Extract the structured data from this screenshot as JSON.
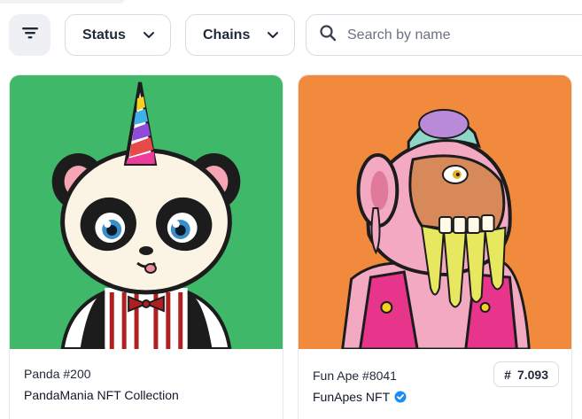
{
  "toolbar": {
    "filter_icon": "filter-lines-icon",
    "status_label": "Status",
    "chains_label": "Chains",
    "search_placeholder": "Search by name"
  },
  "cards": [
    {
      "name": "Panda #200",
      "collection": "PandaMania NFT Collection",
      "image_bg": "#3fb86a",
      "verified": false
    },
    {
      "name": "Fun Ape #8041",
      "collection": "FunApes NFT",
      "image_bg": "#f28a3d",
      "verified": true,
      "price_symbol": "#",
      "price": "7.093"
    }
  ],
  "colors": {
    "verified_blue": "#1d8cf0",
    "border": "#d8dce2"
  }
}
